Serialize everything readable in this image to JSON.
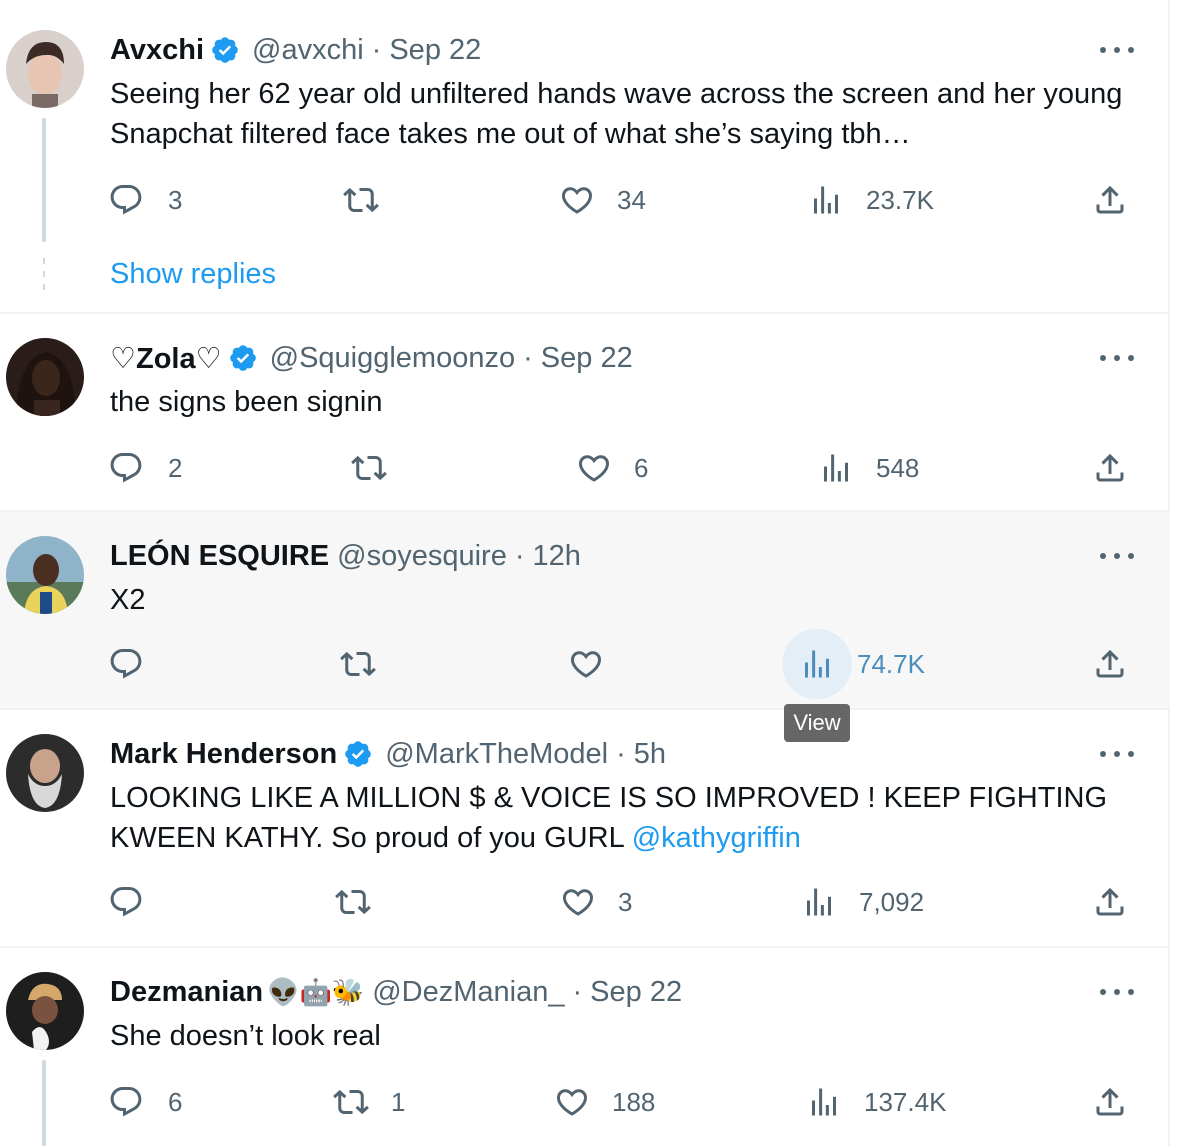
{
  "tweets": [
    {
      "name": "Avxchi",
      "verified": true,
      "handle": "@avxchi",
      "time": "Sep 22",
      "text": "Seeing her 62 year old unfiltered hands wave across the screen and her young Snapchat filtered face takes me out of what she’s saying tbh…",
      "replies": "3",
      "retweets": "",
      "likes": "34",
      "views": "23.7K",
      "show_replies": "Show replies"
    },
    {
      "name": "♡Zola♡",
      "verified": true,
      "handle": "@Squigglemoonzo",
      "time": "Sep 22",
      "text": "the signs been signin",
      "replies": "2",
      "retweets": "",
      "likes": "6",
      "views": "548"
    },
    {
      "name": "LEÓN ESQUIRE",
      "verified": false,
      "handle": "@soyesquire",
      "time": "12h",
      "text": "X2",
      "replies": "",
      "retweets": "",
      "likes": "",
      "views": "74.7K",
      "tooltip": "View"
    },
    {
      "name": "Mark Henderson",
      "verified": true,
      "handle": "@MarkTheModel",
      "time": "5h",
      "text": "LOOKING LIKE A MILLION $ & VOICE IS SO IMPROVED ! KEEP FIGHTING KWEEN KATHY. So proud of you GURL",
      "mention": "@kathygriffin",
      "replies": "",
      "retweets": "",
      "likes": "3",
      "views": "7,092"
    },
    {
      "name": "Dezmanian",
      "emoji": "👽🤖🐝",
      "verified": false,
      "handle": "@DezManian_",
      "time": "Sep 22",
      "text": "She doesn’t look real",
      "replies": "6",
      "retweets": "1",
      "likes": "188",
      "views": "137.4K"
    }
  ],
  "separator": "·",
  "colors": {
    "accent": "#1d9bf0",
    "verified": "#1d9bf0",
    "muted": "#536471",
    "hover_bg": "#f7f7f7"
  },
  "icons": [
    "reply-icon",
    "retweet-icon",
    "like-icon",
    "views-icon",
    "share-icon",
    "more-icon",
    "verified-badge-icon"
  ]
}
